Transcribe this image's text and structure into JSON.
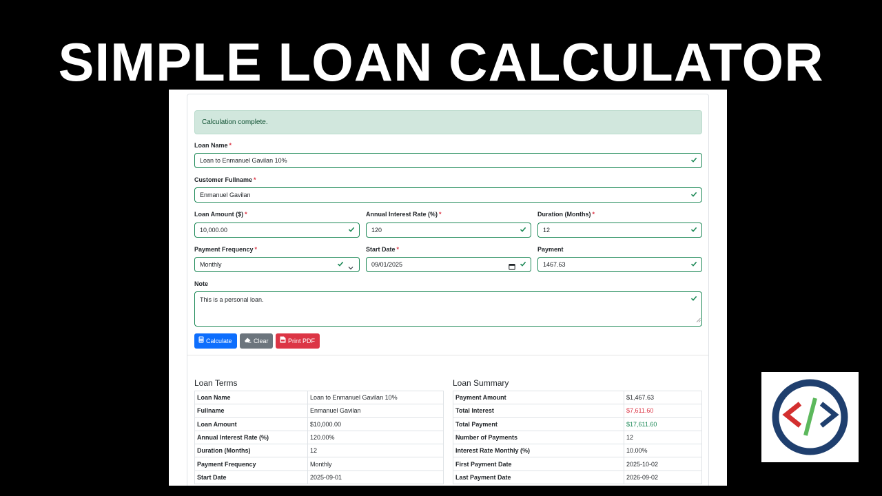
{
  "banner": {
    "title": "SIMPLE LOAN CALCULATOR"
  },
  "alert": {
    "text": "Calculation complete."
  },
  "form": {
    "loan_name": {
      "label": "Loan Name",
      "required": "*",
      "value": "Loan to Enmanuel Gavilan 10%"
    },
    "customer_fullname": {
      "label": "Customer Fullname",
      "required": "*",
      "value": "Enmanuel Gavilan"
    },
    "loan_amount": {
      "label": "Loan Amount ($)",
      "required": "*",
      "value": "10,000.00"
    },
    "annual_interest_rate": {
      "label": "Annual Interest Rate (%)",
      "required": "*",
      "value": "120"
    },
    "duration_months": {
      "label": "Duration (Months)",
      "required": "*",
      "value": "12"
    },
    "payment_frequency": {
      "label": "Payment Frequency",
      "required": "*",
      "value": "Monthly"
    },
    "start_date": {
      "label": "Start Date",
      "required": "*",
      "value": "09/01/2025"
    },
    "payment": {
      "label": "Payment",
      "value": "1467.63"
    },
    "note": {
      "label": "Note",
      "value": "This is a personal loan."
    }
  },
  "buttons": {
    "calculate": "Calculate",
    "clear": "Clear",
    "print_pdf": "Print PDF"
  },
  "loan_terms": {
    "title": "Loan Terms",
    "rows": [
      {
        "key": "Loan Name",
        "value": "Loan to Enmanuel Gavilan 10%"
      },
      {
        "key": "Fullname",
        "value": "Enmanuel Gavilan"
      },
      {
        "key": "Loan Amount",
        "value": "$10,000.00"
      },
      {
        "key": "Annual Interest Rate (%)",
        "value": "120.00%"
      },
      {
        "key": "Duration (Months)",
        "value": "12"
      },
      {
        "key": "Payment Frequency",
        "value": "Monthly"
      },
      {
        "key": "Start Date",
        "value": "2025-09-01"
      }
    ]
  },
  "loan_summary": {
    "title": "Loan Summary",
    "rows": [
      {
        "key": "Payment Amount",
        "value": "$1,467.63"
      },
      {
        "key": "Total Interest",
        "value": "$7,611.60"
      },
      {
        "key": "Total Payment",
        "value": "$17,611.60"
      },
      {
        "key": "Number of Payments",
        "value": "12"
      },
      {
        "key": "Interest Rate Monthly (%)",
        "value": "10.00%"
      },
      {
        "key": "First Payment Date",
        "value": "2025-10-02"
      },
      {
        "key": "Last Payment Date",
        "value": "2026-09-02"
      }
    ]
  },
  "colors": {
    "valid": "#198754",
    "primary": "#0d6efd",
    "secondary": "#6c757d",
    "danger": "#dc3545",
    "alert_bg": "#d1e7dd",
    "logo_ring": "#1f3f6e",
    "logo_left": "#d32f2f",
    "logo_slash": "#5cb85c"
  },
  "icons": {
    "valid": "check-icon",
    "calculate": "calculator-icon",
    "clear": "eraser-icon",
    "print_pdf": "file-pdf-icon",
    "select": "chevron-down-icon",
    "date": "calendar-icon",
    "logo": "code-brackets-logo"
  }
}
